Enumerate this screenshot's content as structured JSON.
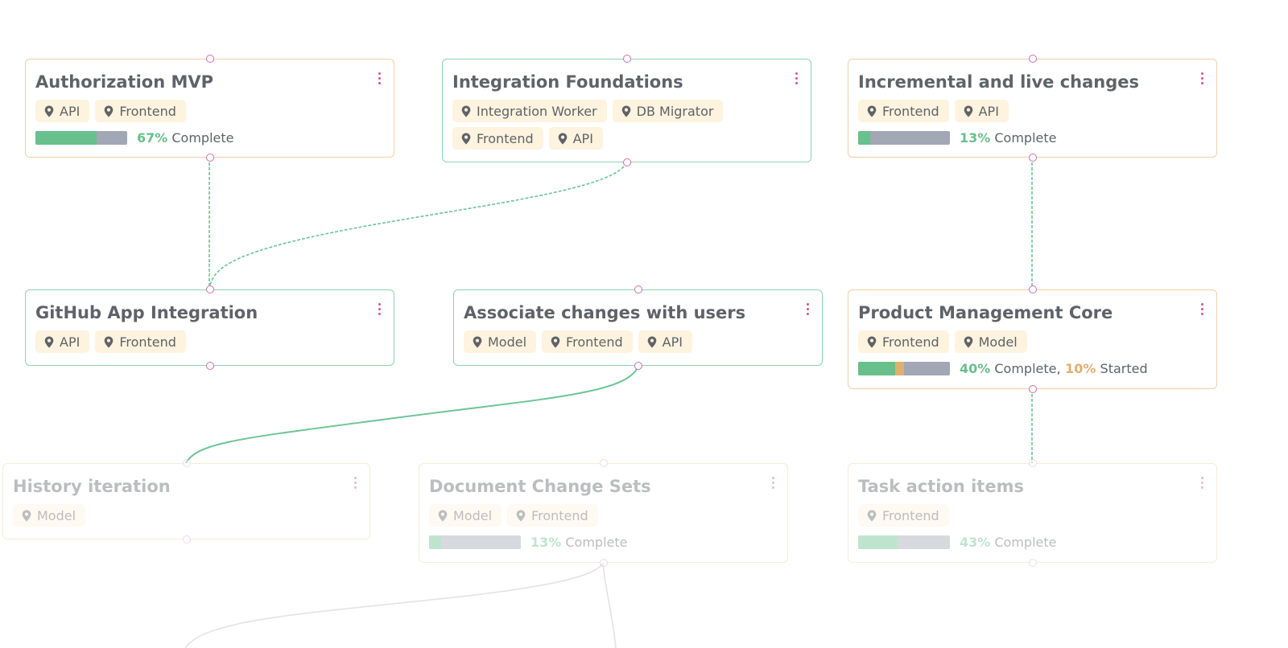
{
  "colors": {
    "accent_green": "#68c08c",
    "accent_amber": "#dfb06e",
    "bar_track": "#a2a7b5",
    "tag_bg": "#fdf3de",
    "menu_icon": "#d4548c"
  },
  "complete_label": "Complete",
  "started_label": "Started",
  "nodes": [
    {
      "title": "Authorization MVP",
      "tags": [
        "API",
        "Frontend"
      ],
      "progress": {
        "complete": 67
      }
    },
    {
      "title": "Integration Foundations",
      "tags": [
        "Integration Worker",
        "DB Migrator",
        "Frontend",
        "API"
      ]
    },
    {
      "title": "Incremental and live changes",
      "tags": [
        "Frontend",
        "API"
      ],
      "progress": {
        "complete": 13
      }
    },
    {
      "title": "GitHub App Integration",
      "tags": [
        "API",
        "Frontend"
      ]
    },
    {
      "title": "Associate changes with users",
      "tags": [
        "Model",
        "Frontend",
        "API"
      ]
    },
    {
      "title": "Product Management Core",
      "tags": [
        "Frontend",
        "Model"
      ],
      "progress": {
        "complete": 40,
        "started": 10
      }
    },
    {
      "title": "History iteration",
      "tags": [
        "Model"
      ]
    },
    {
      "title": "Document Change Sets",
      "tags": [
        "Model",
        "Frontend"
      ],
      "progress": {
        "complete": 13
      }
    },
    {
      "title": "Task action items",
      "tags": [
        "Frontend"
      ],
      "progress": {
        "complete": 43
      }
    }
  ],
  "edges": [
    {
      "from": "Authorization MVP",
      "to": "GitHub App Integration",
      "style": "dashed"
    },
    {
      "from": "Integration Foundations",
      "to": "GitHub App Integration",
      "style": "dashed"
    },
    {
      "from": "Incremental and live changes",
      "to": "Product Management Core",
      "style": "dashed"
    },
    {
      "from": "Associate changes with users",
      "to": "History iteration",
      "style": "solid"
    },
    {
      "from": "Product Management Core",
      "to": "Task action items",
      "style": "dashed"
    }
  ],
  "icons": {
    "tag": "map-pin-icon",
    "menu": "more-vertical-icon"
  }
}
